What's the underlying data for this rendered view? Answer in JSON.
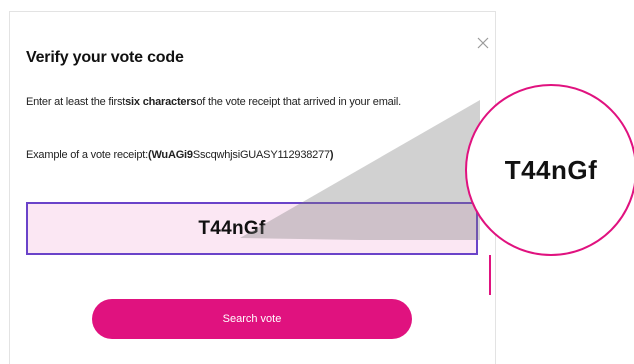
{
  "dialog": {
    "title": "Verify your vote code",
    "instruction": {
      "before": "Enter at least the first",
      "emphasis": "six characters",
      "after": "of the vote receipt that arrived in your email."
    },
    "example": {
      "label": "Example of a vote receipt:",
      "open_brace": "(",
      "highlight": "WuAGi9",
      "rest": "SscqwhjsiGUASY112938277",
      "close_brace": ")"
    },
    "code_input": {
      "value": "T44nGf"
    },
    "search_button_label": "Search vote"
  },
  "magnifier": {
    "text": "T44nGf"
  },
  "colors": {
    "accent": "#e0127f",
    "input_border": "#6a43c9",
    "input_fill": "#fbe7f3"
  }
}
